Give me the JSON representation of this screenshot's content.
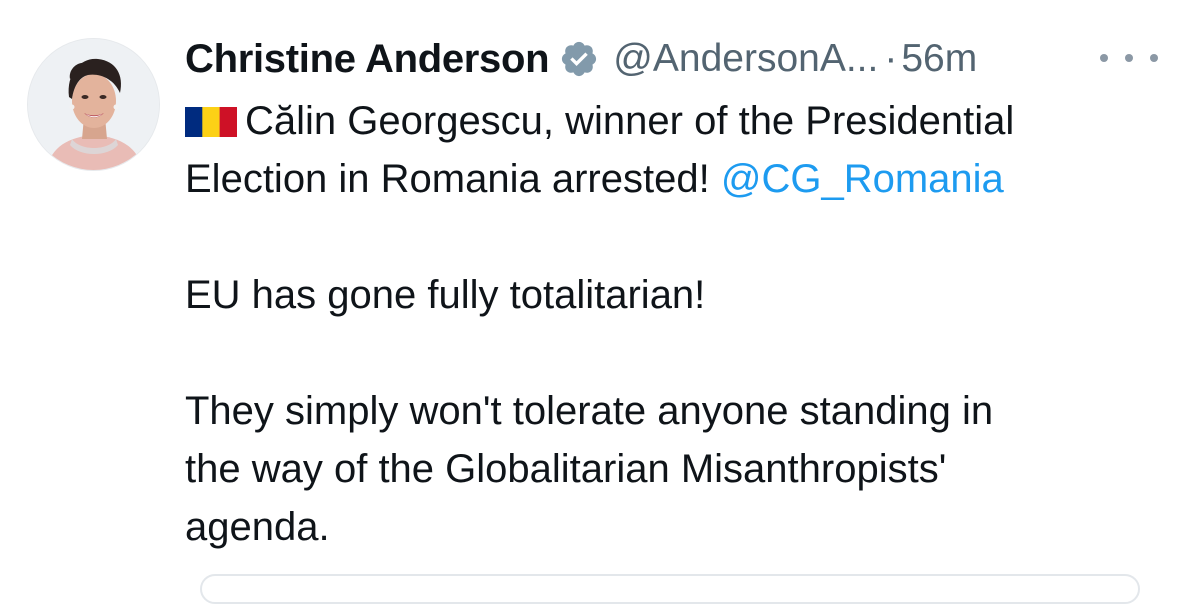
{
  "tweet": {
    "author_name": "Christine Anderson",
    "handle": "@AndersonA...",
    "separator": "·",
    "time": "56m",
    "lines": {
      "line1_text": "Călin Georgescu, winner of the Presidential",
      "line2_text": "Election in Romania arrested!",
      "mention": "@CG_Romania",
      "paragraph2": "EU has gone fully totalitarian!",
      "paragraph3_line1": "They simply won't tolerate anyone standing in",
      "paragraph3_line2": "the way of the Globalitarian Misanthropists'",
      "paragraph3_line3": "agenda."
    },
    "flag": {
      "country": "Romania",
      "colors": [
        "#002b7f",
        "#fcd116",
        "#ce1126"
      ]
    }
  },
  "colors": {
    "text": "#0f1419",
    "secondary": "#536471",
    "link": "#1d9bf0",
    "verified_badge": "#829aab"
  },
  "icons": {
    "verified": "verified-badge-icon",
    "more": "more-options-icon"
  }
}
